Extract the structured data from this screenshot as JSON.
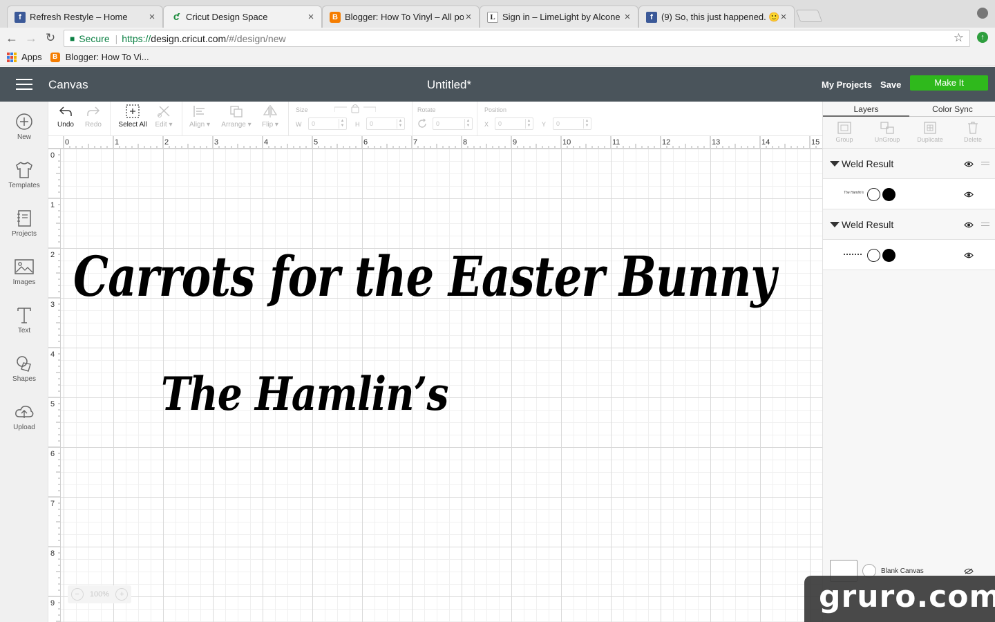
{
  "browser": {
    "tabs": [
      {
        "title": "Refresh Restyle – Home",
        "favicon": "facebook-icon",
        "color": "#3b5998"
      },
      {
        "title": "Cricut Design Space",
        "favicon": "cricut-icon",
        "color": "#1a8a3a"
      },
      {
        "title": "Blogger: How To Vinyl – All po",
        "favicon": "blogger-icon",
        "color": "#f57d00"
      },
      {
        "title": "Sign in – LimeLight by Alcone",
        "favicon": "limelight-icon",
        "color": "#ffffff"
      },
      {
        "title": "(9) So, this just happened. 🙂",
        "favicon": "facebook-icon",
        "color": "#3b5998"
      }
    ],
    "active_tab": 1,
    "address": {
      "secure_label": "Secure",
      "scheme": "https://",
      "host": "design.cricut.com",
      "path": "/#/design/new"
    },
    "bookmarks": [
      {
        "label": "Apps",
        "icon": "apps-grid-icon"
      },
      {
        "label": "Blogger: How To Vi...",
        "icon": "blogger-icon"
      }
    ]
  },
  "app": {
    "section_title": "Canvas",
    "document_title": "Untitled*",
    "my_projects_label": "My Projects",
    "save_label": "Save",
    "make_it_label": "Make It",
    "accent_color": "#2fb91c",
    "header_color": "#4a545b"
  },
  "sidebar": {
    "items": [
      {
        "label": "New",
        "icon": "plus-circle-icon"
      },
      {
        "label": "Templates",
        "icon": "shirt-icon"
      },
      {
        "label": "Projects",
        "icon": "notebook-icon"
      },
      {
        "label": "Images",
        "icon": "image-icon"
      },
      {
        "label": "Text",
        "icon": "text-icon"
      },
      {
        "label": "Shapes",
        "icon": "shapes-icon"
      },
      {
        "label": "Upload",
        "icon": "upload-cloud-icon"
      }
    ]
  },
  "toolbar": {
    "undo": "Undo",
    "redo": "Redo",
    "select_all": "Select All",
    "edit": "Edit",
    "align": "Align",
    "arrange": "Arrange",
    "flip": "Flip",
    "size_label": "Size",
    "w_label": "W",
    "w_value": "0",
    "h_label": "H",
    "h_value": "0",
    "rotate_label": "Rotate",
    "rotate_value": "0",
    "position_label": "Position",
    "x_label": "X",
    "x_value": "0",
    "y_label": "Y",
    "y_value": "0"
  },
  "rulers": {
    "top_ticks": [
      "0",
      "1",
      "2",
      "3",
      "4",
      "5",
      "6",
      "7",
      "8",
      "9",
      "10",
      "11",
      "12",
      "13",
      "14",
      "15"
    ],
    "left_ticks": [
      "0",
      "1",
      "2",
      "3",
      "4",
      "5",
      "6",
      "7",
      "8",
      "9"
    ]
  },
  "canvas": {
    "line1": "Carrots   for   the   Easter   Bunny",
    "line2": "The  Hamlin’s",
    "zoom_minus": "−",
    "zoom_level": "100%",
    "zoom_plus": "+"
  },
  "panel": {
    "tabs": [
      "Layers",
      "Color Sync"
    ],
    "active_tab": 0,
    "tools": [
      "Group",
      "UnGroup",
      "Duplicate",
      "Delete"
    ],
    "groups": [
      {
        "label": "Weld Result",
        "thumb": "The Hamlin's"
      },
      {
        "label": "Weld Result",
        "thumb": ""
      }
    ],
    "blank_canvas_label": "Blank Canvas"
  },
  "watermark": "gruro.com"
}
